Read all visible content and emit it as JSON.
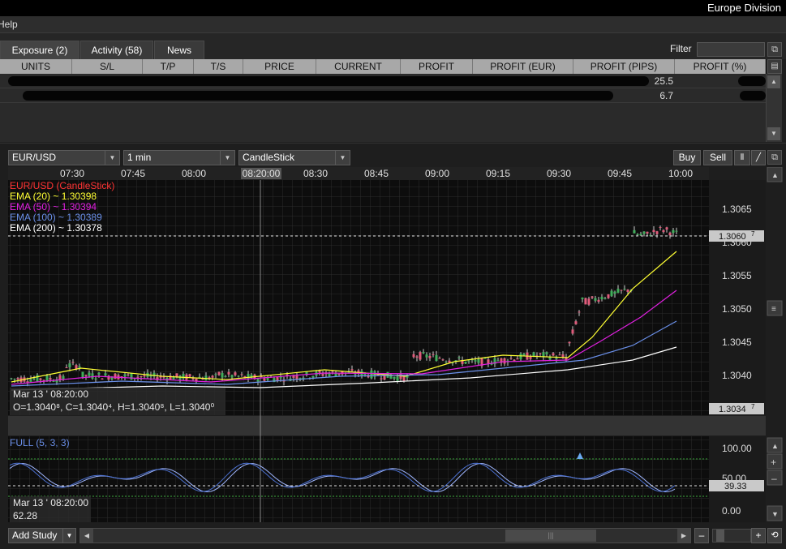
{
  "app": {
    "division": "Europe Division",
    "menu_help": "Help"
  },
  "tabs": {
    "exposure": "Exposure (2)",
    "activity": "Activity (58)",
    "news": "News"
  },
  "filter": {
    "label": "Filter",
    "value": ""
  },
  "grid": {
    "columns": [
      "UNITS",
      "S/L",
      "T/P",
      "T/S",
      "PRICE",
      "CURRENT",
      "PROFIT",
      "PROFIT (EUR)",
      "PROFIT (PIPS)",
      "PROFIT (%)"
    ],
    "rows": [
      {
        "profit_pips": "25.5"
      },
      {
        "profit_pips": "6.7"
      }
    ]
  },
  "toolbar": {
    "instrument": "EUR/USD",
    "interval": "1 min",
    "chart_type": "CandleStick",
    "buy": "Buy",
    "sell": "Sell"
  },
  "chart": {
    "time_labels": [
      "07:30",
      "07:45",
      "08:00",
      "08:20:00",
      "08:30",
      "08:45",
      "09:00",
      "09:15",
      "09:30",
      "09:45",
      "10:00"
    ],
    "highlight_time": "08:20:00",
    "price_ticks": [
      "1.3065",
      "1.3060",
      "1.3055",
      "1.3050",
      "1.3045",
      "1.3040"
    ],
    "current_price": "1.3060",
    "current_price_sup": "7",
    "cursor_price": "1.3034",
    "cursor_price_sup": "7",
    "legend": [
      {
        "text": "EUR/USD (CandleStick)",
        "color": "#ff3333"
      },
      {
        "text": "EMA (20) ~ 1.30398",
        "color": "#ffff33"
      },
      {
        "text": "EMA (50) ~ 1.30394",
        "color": "#e020e0"
      },
      {
        "text": "EMA (100) ~ 1.30389",
        "color": "#6a8fe8"
      },
      {
        "text": "EMA (200) ~ 1.30378",
        "color": "#ffffff"
      }
    ],
    "info_date": "Mar 13 ' 08:20:00",
    "info_ohlc": "O=1.3040⁸, C=1.3040⁴, H=1.3040⁸, L=1.3040⁰",
    "osc_title": "FULL (5, 3, 3)",
    "osc_ticks": [
      "100.00",
      "50.00",
      "0.00"
    ],
    "osc_current": "39.33",
    "osc_date": "Mar 13 ' 08:20:00",
    "osc_value": "62.28"
  },
  "bottom": {
    "add_study": "Add Study"
  }
}
